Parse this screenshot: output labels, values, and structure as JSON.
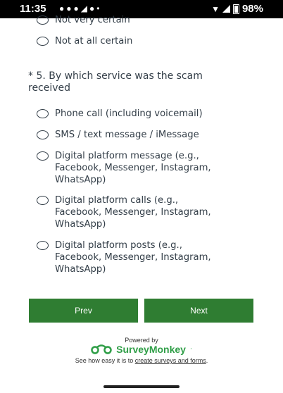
{
  "status_bar": {
    "time": "11:35",
    "battery": "98%"
  },
  "prev_question_options": [
    "Not very certain",
    "Not at all certain"
  ],
  "question": {
    "text": "* 5. By which service was the scam received",
    "options": [
      "Phone call (including voicemail)",
      "SMS / text message / iMessage",
      "Digital platform message (e.g.,\nFacebook, Messenger, Instagram,\nWhatsApp)",
      "Digital platform calls (e.g.,\nFacebook, Messenger, Instagram,\nWhatsApp)",
      "Digital platform posts (e.g.,\nFacebook, Messenger, Instagram,\nWhatsApp)"
    ]
  },
  "nav": {
    "prev_label": "Prev",
    "next_label": "Next"
  },
  "footer": {
    "powered_by": "Powered by",
    "brand": "SurveyMonkey",
    "brand_mark": "·",
    "tagline_prefix": "See how easy it is to ",
    "tagline_link": "create surveys and forms",
    "tagline_suffix": "."
  },
  "colors": {
    "button": "#2f7d32",
    "brand": "#2f9e47",
    "text": "#333e48"
  }
}
